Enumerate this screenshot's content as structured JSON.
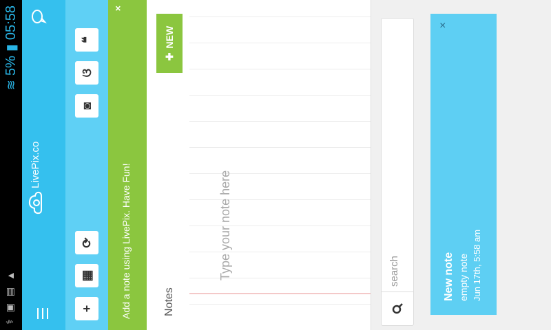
{
  "status": {
    "battery_percent": "5%",
    "time": "05:58"
  },
  "app": {
    "logo_text": "LivePix.co"
  },
  "banner": {
    "message": "Add a note using LivePix. Have Fun!",
    "close": "×"
  },
  "notes": {
    "title": "Notes",
    "new_label": "NEW",
    "placeholder": "Type your note here"
  },
  "search": {
    "placeholder": "search"
  },
  "note_item": {
    "title": "New note",
    "subtitle": "empty note",
    "timestamp": "Jun 17th, 5:58 am",
    "close": "×"
  },
  "colors": {
    "appbar": "#35c0ee",
    "toolbar": "#5fd0f5",
    "banner": "#8bc63f",
    "note_card": "#5ecff3"
  }
}
